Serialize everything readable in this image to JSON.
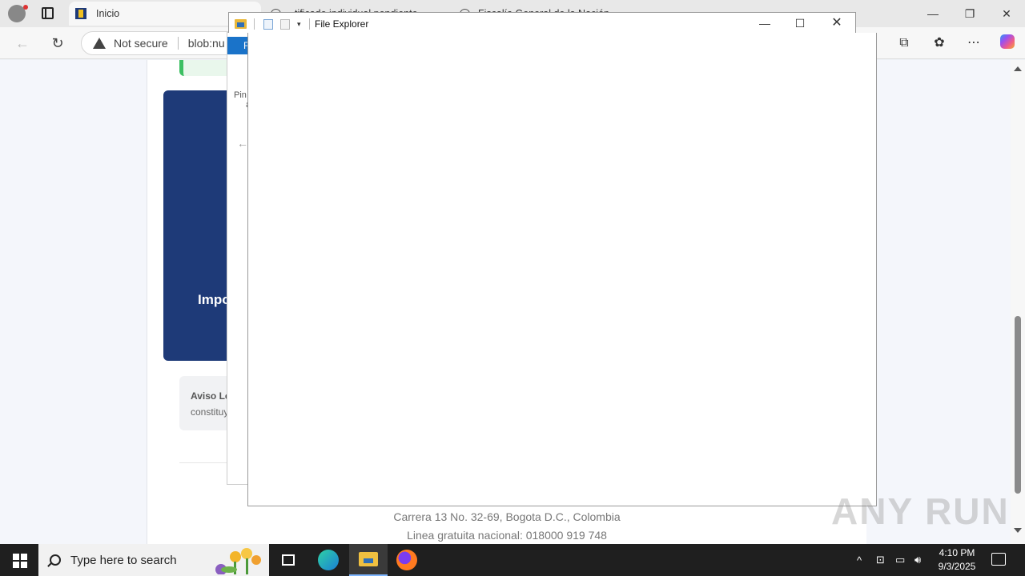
{
  "browser": {
    "tabs": [
      {
        "label": "Inicio"
      },
      {
        "label": "..tificado individual pendiente"
      },
      {
        "label": "Fiscalía General de la Nación"
      }
    ],
    "address": {
      "security_label": "Not secure",
      "url": "blob:nu"
    },
    "window_controls": {
      "minimize": "—",
      "restore": "❐",
      "close": "✕"
    }
  },
  "webpage": {
    "card_title": "Impo",
    "notice_title": "Aviso Le",
    "notice_body": "constituy",
    "footer_address": "Carrera 13 No. 32-69, Bogota D.C., Colombia",
    "footer_line": "Linea gratuita nacional: 018000 919 748"
  },
  "file_explorer_behind": {
    "ribbon_label": "F",
    "pin_label": "Pin",
    "pin_sub": "a"
  },
  "file_explorer": {
    "title": "File Explorer",
    "controls": {
      "minimize": "—",
      "maximize": "☐",
      "close": "✕"
    }
  },
  "watermark": "ANY RUN",
  "taskbar": {
    "search_placeholder": "Type here to search",
    "time": "4:10 PM",
    "date": "9/3/2025"
  },
  "colors": {
    "page_blue": "#1e3a78",
    "accent_green": "#3cbf62",
    "ribbon_blue": "#1a73c9",
    "taskbar": "#1f1f1f"
  }
}
